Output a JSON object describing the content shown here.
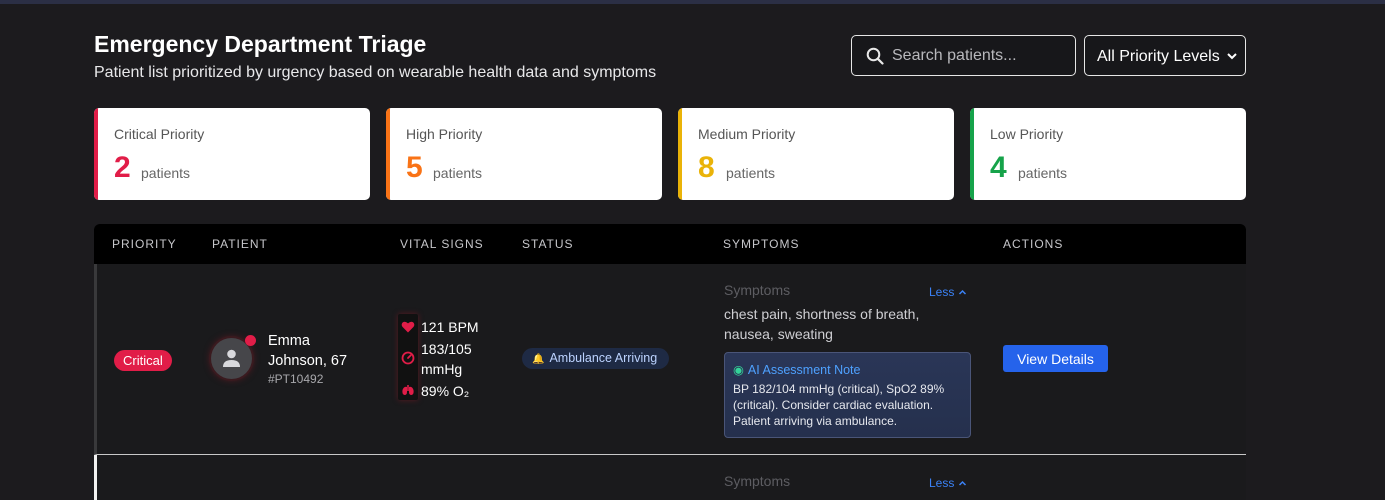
{
  "header": {
    "title": "Emergency Department Triage",
    "subtitle": "Patient list prioritized by urgency based on wearable health data and symptoms"
  },
  "search": {
    "placeholder": "Search patients...",
    "value": ""
  },
  "filter": {
    "selected": "All Priority Levels"
  },
  "summary": [
    {
      "label": "Critical Priority",
      "count": "2",
      "unit": "patients",
      "color": "#e11d48"
    },
    {
      "label": "High Priority",
      "count": "5",
      "unit": "patients",
      "color": "#f97316"
    },
    {
      "label": "Medium Priority",
      "count": "8",
      "unit": "patients",
      "color": "#eab308"
    },
    {
      "label": "Low Priority",
      "count": "4",
      "unit": "patients",
      "color": "#16a34a"
    }
  ],
  "table": {
    "columns": [
      "PRIORITY",
      "PATIENT",
      "VITAL SIGNS",
      "STATUS",
      "SYMPTOMS",
      "ACTIONS"
    ],
    "rows": [
      {
        "priority": "Critical",
        "name": "Emma Johnson, 67",
        "id": "#PT10492",
        "vitals": {
          "heart_rate": "121 BPM",
          "bp": "183/105 mmHg",
          "spo2": "89% O₂"
        },
        "status": "Ambulance Arriving",
        "symptoms_label": "Symptoms",
        "toggle": "Less",
        "symptoms": "chest pain, shortness of breath, nausea, sweating",
        "ai_title": "AI Assessment Note",
        "ai_note": "BP 182/104 mmHg (critical), SpO2 89% (critical). Consider cardiac evaluation. Patient arriving via ambulance.",
        "action": "View Details"
      },
      {
        "symptoms_label": "Symptoms",
        "toggle": "Less"
      }
    ]
  },
  "icons": [
    "search-icon",
    "chevron-down-icon",
    "user-icon",
    "heart-icon",
    "gauge-icon",
    "lungs-icon",
    "bell-icon",
    "robot-icon",
    "chevron-up-icon"
  ]
}
